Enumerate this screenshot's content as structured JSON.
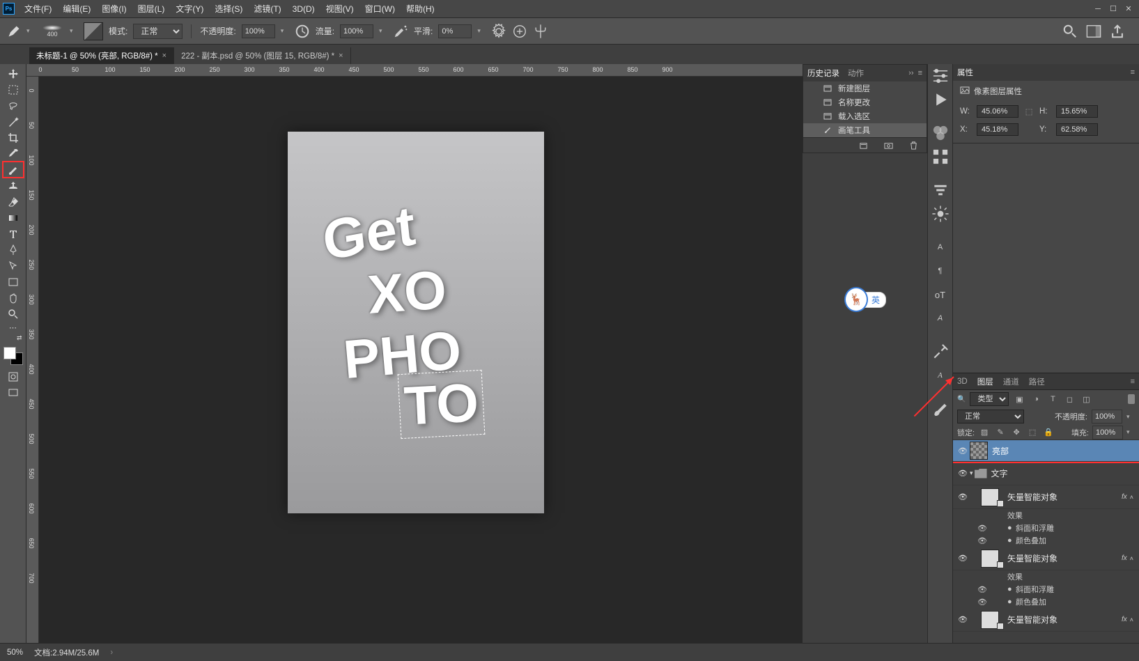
{
  "menu": {
    "file": "文件(F)",
    "edit": "编辑(E)",
    "image": "图像(I)",
    "layer": "图层(L)",
    "type": "文字(Y)",
    "select": "选择(S)",
    "filter": "滤镜(T)",
    "threeD": "3D(D)",
    "view": "视图(V)",
    "window": "窗口(W)",
    "help": "帮助(H)"
  },
  "options": {
    "brush_size": "400",
    "mode_label": "模式:",
    "mode_value": "正常",
    "opacity_label": "不透明度:",
    "opacity_value": "100%",
    "flow_label": "流量:",
    "flow_value": "100%",
    "smooth_label": "平滑:",
    "smooth_value": "0%"
  },
  "tabs": {
    "tab1": "未标题-1 @ 50% (亮部, RGB/8#) *",
    "tab2": "222 - 副本.psd @ 50% (图层 15, RGB/8#) *"
  },
  "ruler_h": [
    "0",
    "50",
    "100",
    "150",
    "200",
    "250",
    "300",
    "350",
    "400",
    "450",
    "500",
    "550",
    "600",
    "650",
    "700",
    "750",
    "800",
    "850",
    "900"
  ],
  "ruler_v": [
    "0",
    "50",
    "100",
    "150",
    "200",
    "250",
    "300",
    "350",
    "400",
    "450",
    "500",
    "550",
    "600",
    "650",
    "700"
  ],
  "history": {
    "tab1": "历史记录",
    "tab2": "动作",
    "items": [
      {
        "label": "新建图层"
      },
      {
        "label": "名称更改"
      },
      {
        "label": "载入选区"
      },
      {
        "label": "画笔工具"
      }
    ]
  },
  "properties": {
    "title": "属性",
    "subtitle": "像素图层属性",
    "w_label": "W:",
    "w_value": "45.06%",
    "h_label": "H:",
    "h_value": "15.65%",
    "x_label": "X:",
    "x_value": "45.18%",
    "y_label": "Y:",
    "y_value": "62.58%"
  },
  "layersPanel": {
    "tabs": {
      "threeD": "3D",
      "layers": "图层",
      "channels": "通道",
      "paths": "路径"
    },
    "filter_label": "类型",
    "blend_mode": "正常",
    "opacity_label": "不透明度:",
    "opacity_value": "100%",
    "lock_label": "锁定:",
    "fill_label": "填充:",
    "fill_value": "100%",
    "rows": [
      {
        "name": "亮部",
        "type": "pixel",
        "sel": true,
        "indent": 0
      },
      {
        "name": "文字",
        "type": "group",
        "indent": 0
      },
      {
        "name": "矢量智能对象",
        "type": "smart",
        "indent": 1,
        "fx": true
      },
      {
        "name": "效果",
        "type": "effect",
        "indent": 2
      },
      {
        "name": "斜面和浮雕",
        "type": "effect-item",
        "indent": 2
      },
      {
        "name": "颜色叠加",
        "type": "effect-item",
        "indent": 2
      },
      {
        "name": "矢量智能对象",
        "type": "smart",
        "indent": 1,
        "fx": true
      },
      {
        "name": "效果",
        "type": "effect",
        "indent": 2
      },
      {
        "name": "斜面和浮雕",
        "type": "effect-item",
        "indent": 2
      },
      {
        "name": "颜色叠加",
        "type": "effect-item",
        "indent": 2
      },
      {
        "name": "矢量智能对象",
        "type": "smart",
        "indent": 1,
        "fx": true
      }
    ]
  },
  "status": {
    "zoom": "50%",
    "doc": "文档:2.94M/25.6M"
  },
  "ime": {
    "icon": "🦌",
    "lang": "英"
  },
  "canvas_text": {
    "l1": "Get",
    "l2": "XO",
    "l3": "PHO",
    "l4": "TO"
  }
}
